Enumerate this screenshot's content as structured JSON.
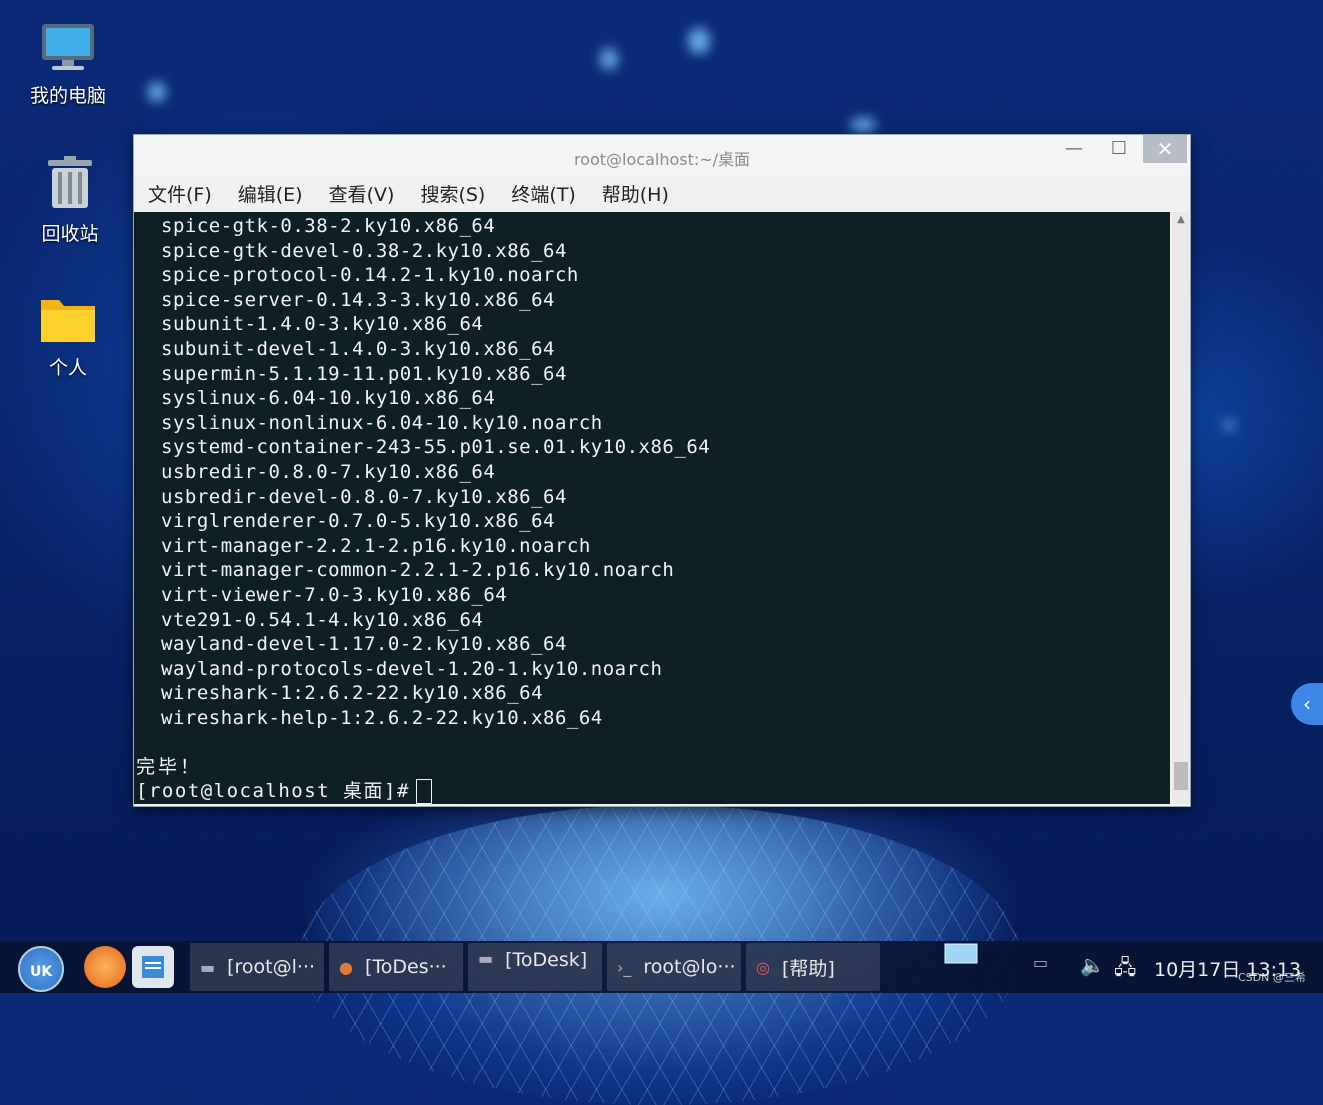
{
  "desktop": {
    "icons": [
      {
        "label": "我的电脑",
        "icon": "computer-icon"
      },
      {
        "label": "回收站",
        "icon": "trash-icon"
      },
      {
        "label": "个人",
        "icon": "folder-icon"
      }
    ]
  },
  "window": {
    "title": "root@localhost:~/桌面",
    "controls": {
      "minimize": "—",
      "maximize": "☐",
      "close": "✕"
    },
    "menu": [
      "文件(F)",
      "编辑(E)",
      "查看(V)",
      "搜索(S)",
      "终端(T)",
      "帮助(H)"
    ]
  },
  "terminal": {
    "lines": [
      "spice-gtk-0.38-2.ky10.x86_64",
      "spice-gtk-devel-0.38-2.ky10.x86_64",
      "spice-protocol-0.14.2-1.ky10.noarch",
      "spice-server-0.14.3-3.ky10.x86_64",
      "subunit-1.4.0-3.ky10.x86_64",
      "subunit-devel-1.4.0-3.ky10.x86_64",
      "supermin-5.1.19-11.p01.ky10.x86_64",
      "syslinux-6.04-10.ky10.x86_64",
      "syslinux-nonlinux-6.04-10.ky10.noarch",
      "systemd-container-243-55.p01.se.01.ky10.x86_64",
      "usbredir-0.8.0-7.ky10.x86_64",
      "usbredir-devel-0.8.0-7.ky10.x86_64",
      "virglrenderer-0.7.0-5.ky10.x86_64",
      "virt-manager-2.2.1-2.p16.ky10.noarch",
      "virt-manager-common-2.2.1-2.p16.ky10.noarch",
      "virt-viewer-7.0-3.ky10.x86_64",
      "vte291-0.54.1-4.ky10.x86_64",
      "wayland-devel-1.17.0-2.ky10.x86_64",
      "wayland-protocols-devel-1.20-1.ky10.noarch",
      "wireshark-1:2.6.2-22.ky10.x86_64",
      "wireshark-help-1:2.6.2-22.ky10.x86_64"
    ],
    "done": "完毕！",
    "prompt": "[root@localhost 桌面]#"
  },
  "taskbar": {
    "tasks": [
      "[root@l···",
      "[ToDes···",
      "[ToDesk]",
      "root@lo···",
      "[帮助]"
    ],
    "clock": "10月17日 13:13",
    "watermark": "CSDN @三希"
  },
  "colors": {
    "terminal_bg": "#0e2026",
    "terminal_fg": "#f2f2f2",
    "taskbar_bg": "#08142f",
    "accent": "#3d86e8"
  }
}
